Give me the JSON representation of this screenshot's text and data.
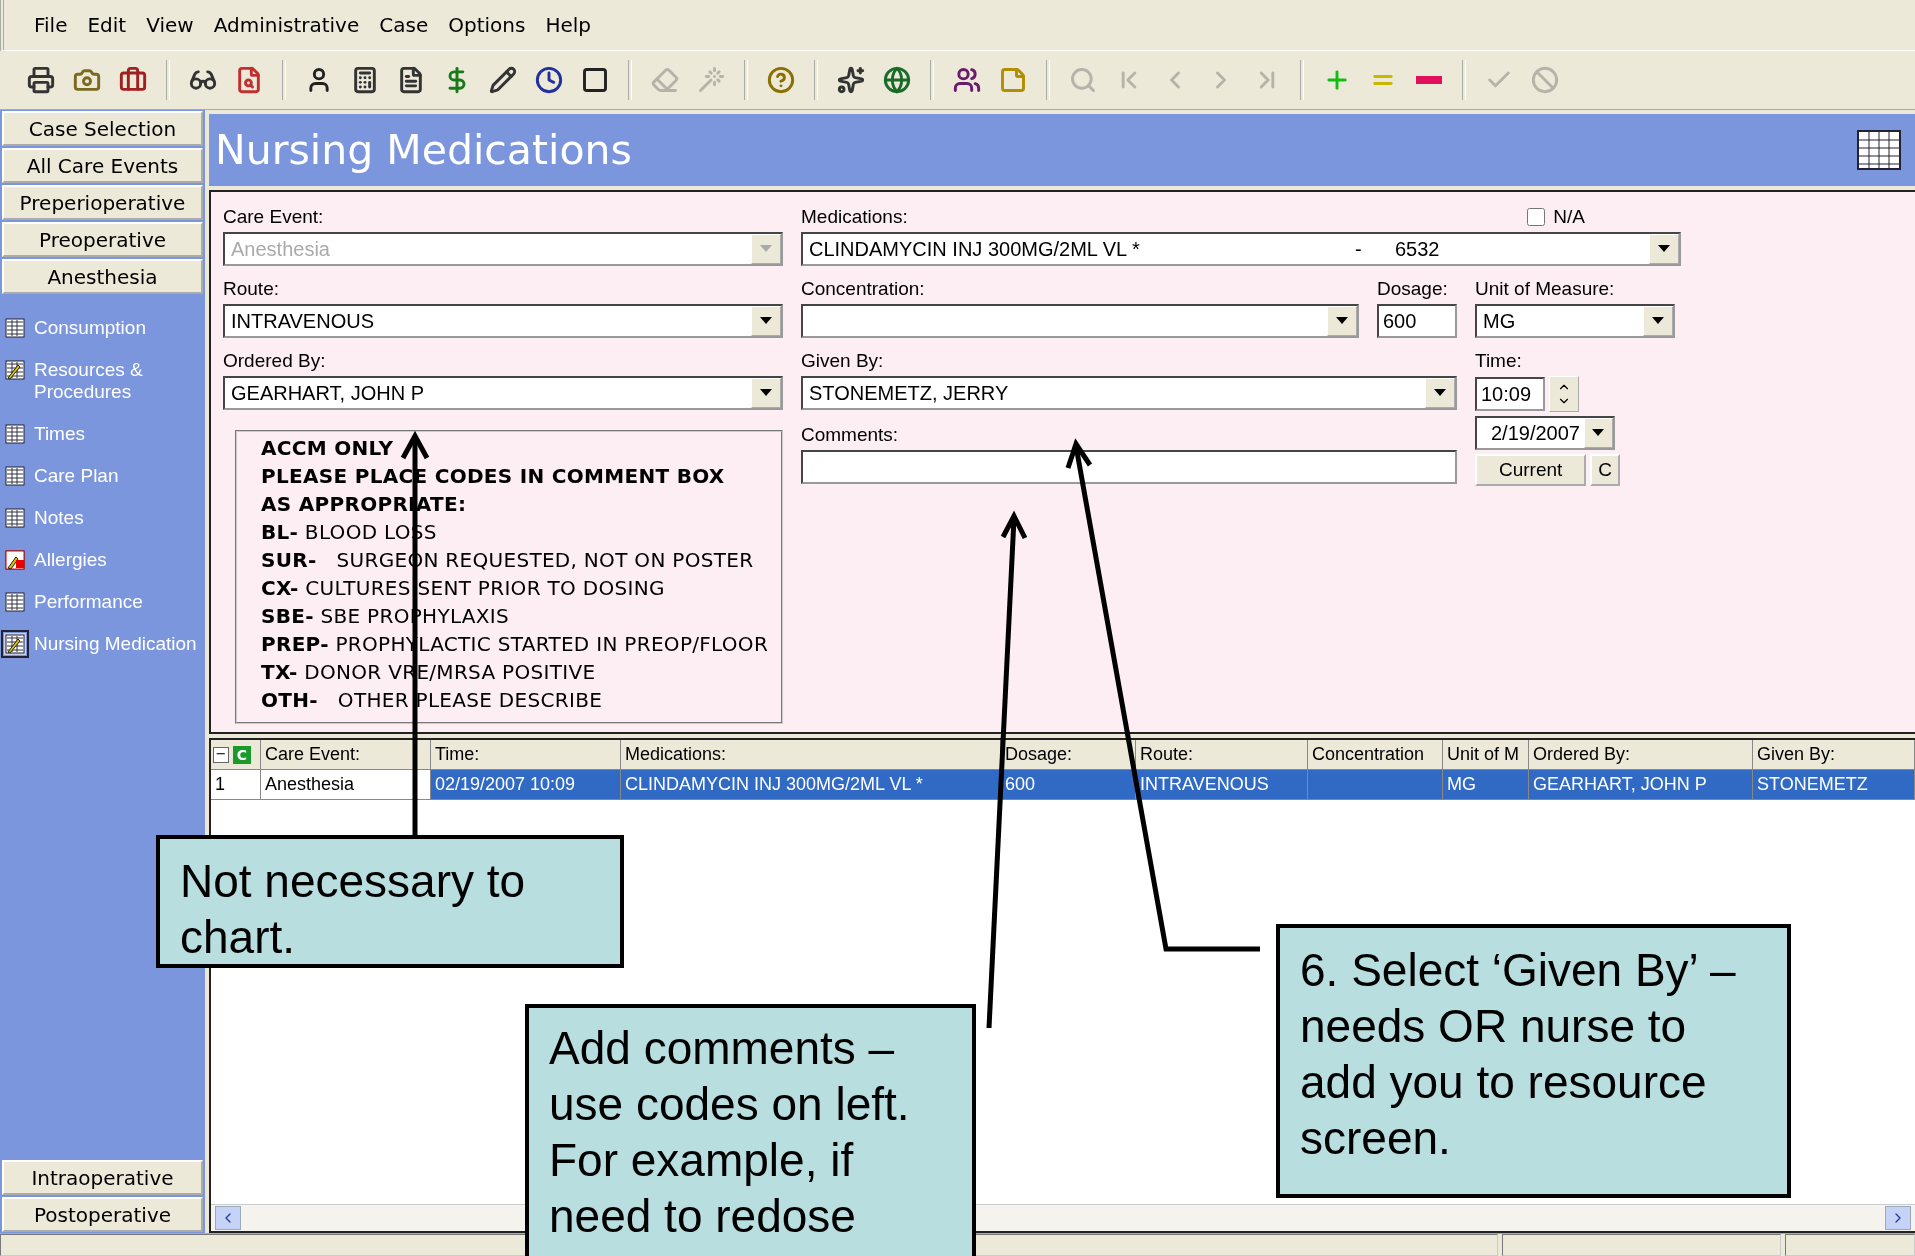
{
  "menu": [
    "File",
    "Edit",
    "View",
    "Administrative",
    "Case",
    "Options",
    "Help"
  ],
  "toolbar": [
    {
      "kind": "printer",
      "disabled": false
    },
    {
      "kind": "camera",
      "disabled": false
    },
    {
      "kind": "briefcase",
      "disabled": false
    },
    {
      "kind": "sep"
    },
    {
      "kind": "glasses",
      "disabled": false
    },
    {
      "kind": "file-search",
      "disabled": false
    },
    {
      "kind": "sep"
    },
    {
      "kind": "user",
      "disabled": false
    },
    {
      "kind": "calculator",
      "disabled": false
    },
    {
      "kind": "file",
      "disabled": false
    },
    {
      "kind": "dollar",
      "disabled": false
    },
    {
      "kind": "pencil",
      "disabled": false
    },
    {
      "kind": "clock",
      "disabled": false
    },
    {
      "kind": "square",
      "disabled": false
    },
    {
      "kind": "sep"
    },
    {
      "kind": "eraser",
      "disabled": true
    },
    {
      "kind": "wand",
      "disabled": true
    },
    {
      "kind": "sep"
    },
    {
      "kind": "help",
      "disabled": false
    },
    {
      "kind": "sep"
    },
    {
      "kind": "sparkles",
      "disabled": false
    },
    {
      "kind": "globe",
      "disabled": false
    },
    {
      "kind": "sep"
    },
    {
      "kind": "users",
      "disabled": false
    },
    {
      "kind": "note",
      "disabled": false
    },
    {
      "kind": "sep"
    },
    {
      "kind": "search",
      "disabled": true
    },
    {
      "kind": "first",
      "disabled": true
    },
    {
      "kind": "prev",
      "disabled": true
    },
    {
      "kind": "next",
      "disabled": true
    },
    {
      "kind": "last",
      "disabled": true
    },
    {
      "kind": "sep"
    },
    {
      "kind": "plus",
      "disabled": false
    },
    {
      "kind": "equal",
      "disabled": false
    },
    {
      "kind": "minus",
      "disabled": false
    },
    {
      "kind": "sep"
    },
    {
      "kind": "check",
      "disabled": true
    },
    {
      "kind": "ban",
      "disabled": true
    }
  ],
  "sidebar": {
    "top_buttons": [
      "Case Selection",
      "All Care Events",
      "Preperioperative",
      "Preoperative",
      "Anesthesia"
    ],
    "items": [
      {
        "label": "Consumption",
        "kind": "grid",
        "selected": false
      },
      {
        "label": "Resources & Procedures",
        "kind": "edit",
        "selected": false
      },
      {
        "label": "Times",
        "kind": "grid",
        "selected": false
      },
      {
        "label": "Care Plan",
        "kind": "grid",
        "selected": false
      },
      {
        "label": "Notes",
        "kind": "grid",
        "selected": false
      },
      {
        "label": "Allergies",
        "kind": "allergy",
        "selected": false
      },
      {
        "label": "Performance",
        "kind": "grid",
        "selected": false
      },
      {
        "label": "Nursing Medication",
        "kind": "edit",
        "selected": true
      }
    ],
    "bottom_buttons": [
      "Intraoperative",
      "Postoperative"
    ]
  },
  "title": "Nursing Medications",
  "form": {
    "care_event": {
      "label": "Care Event:",
      "value": "Anesthesia",
      "disabled": true
    },
    "medications": {
      "label": "Medications:",
      "value": "CLINDAMYCIN INJ 300MG/2ML VL *",
      "separator": "-",
      "code": "6532"
    },
    "na": {
      "label": "N/A",
      "checked": false
    },
    "route": {
      "label": "Route:",
      "value": "INTRAVENOUS"
    },
    "concentration": {
      "label": "Concentration:"
    },
    "dosage": {
      "label": "Dosage:",
      "value": "600"
    },
    "unit": {
      "label": "Unit of Measure:",
      "value": "MG"
    },
    "ordered_by": {
      "label": "Ordered By:",
      "value": "GEARHART, JOHN P"
    },
    "given_by": {
      "label": "Given By:",
      "value": "STONEMETZ, JERRY"
    },
    "time": {
      "label": "Time:",
      "value": "10:09"
    },
    "date": "2/19/2007",
    "current_button": "Current",
    "c_button": "C",
    "comments": {
      "label": "Comments:"
    },
    "notice": [
      "**ACCM ONLY**",
      "**PLEASE PLACE CODES IN COMMENT BOX**",
      "**AS APPROPRIATE:**",
      "**BL-** BLOOD LOSS",
      "**SUR-**   SURGEON REQUESTED, NOT ON POSTER",
      "**CX-** CULTURES SENT PRIOR TO DOSING",
      "**SBE-** SBE PROPHYLAXIS",
      "**PREP-** PROPHYLACTIC STARTED IN PREOP/FLOOR",
      "**TX-** DONOR VRE/MRSA POSITIVE",
      "**OTH-**   OTHER PLEASE DESCRIBE"
    ]
  },
  "table": {
    "collapse": "−",
    "corner_icon": "C",
    "columns": [
      "Care Event:",
      "Time:",
      "Medications:",
      "Dosage:",
      "Route:",
      "Concentration",
      "Unit of M",
      "Ordered By:",
      "Given By:"
    ],
    "rows": [
      {
        "number": "1",
        "selected": true,
        "cells": [
          "Anesthesia",
          "02/19/2007 10:09",
          "CLINDAMYCIN INJ 300MG/2ML VL *",
          "600",
          "INTRAVENOUS",
          "",
          "MG",
          "GEARHART, JOHN P",
          "STONEMETZ"
        ]
      }
    ]
  },
  "callouts": [
    "Not necessary to chart.",
    "Add comments – use codes on left. For example, if need to redose",
    "6. Select ‘Given By’ – needs OR nurse to add you to resource screen."
  ]
}
